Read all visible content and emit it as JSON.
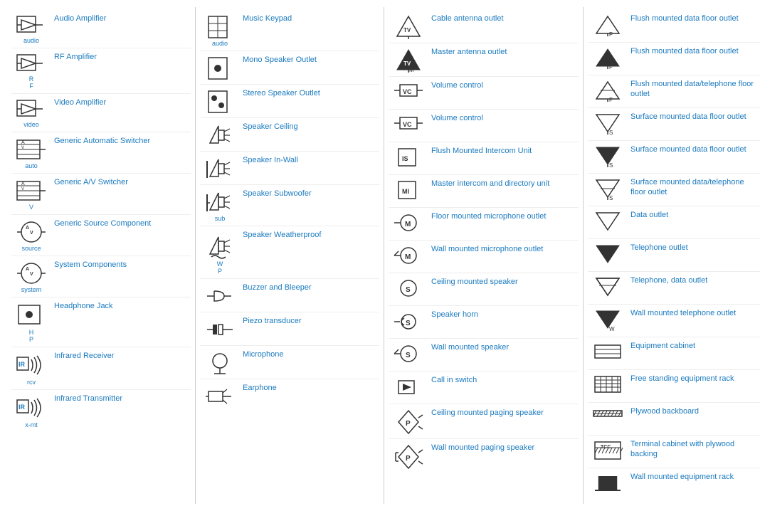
{
  "columns": [
    {
      "items": [
        {
          "id": "audio-amp",
          "label": "Audio Amplifier",
          "abbrev": "audio",
          "symbol": "audio-amp"
        },
        {
          "id": "rf-amp",
          "label": "RF Amplifier",
          "abbrev": "R\nF",
          "symbol": "rf-amp"
        },
        {
          "id": "video-amp",
          "label": "Video Amplifier",
          "abbrev": "video",
          "symbol": "video-amp"
        },
        {
          "id": "generic-auto-switcher",
          "label": "Generic Automatic Switcher",
          "abbrev": "auto",
          "symbol": "auto-switcher"
        },
        {
          "id": "generic-av-switcher",
          "label": "Generic A/V Switcher",
          "abbrev": "V",
          "symbol": "av-switcher"
        },
        {
          "id": "generic-source",
          "label": "Generic Source Component",
          "abbrev": "source",
          "symbol": "source"
        },
        {
          "id": "system-components",
          "label": "System Components",
          "abbrev": "system",
          "symbol": "system"
        },
        {
          "id": "headphone-jack",
          "label": "Headphone Jack",
          "abbrev": "H\nP",
          "symbol": "headphone"
        },
        {
          "id": "infrared-receiver",
          "label": "Infrared Receiver",
          "abbrev": "rcv",
          "symbol": "ir-receiver"
        },
        {
          "id": "infrared-transmitter",
          "label": "Infrared Transmitter",
          "abbrev": "x-mt",
          "symbol": "ir-transmitter"
        }
      ]
    },
    {
      "items": [
        {
          "id": "music-keypad",
          "label": "Music Keypad",
          "abbrev": "audio",
          "symbol": "music-keypad"
        },
        {
          "id": "mono-speaker",
          "label": "Mono Speaker Outlet",
          "abbrev": "",
          "symbol": "mono-speaker"
        },
        {
          "id": "stereo-speaker",
          "label": "Stereo Speaker Outlet",
          "abbrev": "",
          "symbol": "stereo-speaker"
        },
        {
          "id": "speaker-ceiling",
          "label": "Speaker Ceiling",
          "abbrev": "",
          "symbol": "speaker-ceiling"
        },
        {
          "id": "speaker-inwall",
          "label": "Speaker In-Wall",
          "abbrev": "",
          "symbol": "speaker-inwall"
        },
        {
          "id": "speaker-sub",
          "label": "Speaker Subwoofer",
          "abbrev": "sub",
          "symbol": "speaker-sub"
        },
        {
          "id": "speaker-weather",
          "label": "Speaker Weatherproof",
          "abbrev": "W\nP",
          "symbol": "speaker-weather"
        },
        {
          "id": "buzzer",
          "label": "Buzzer and Bleeper",
          "abbrev": "",
          "symbol": "buzzer"
        },
        {
          "id": "piezo",
          "label": "Piezo transducer",
          "abbrev": "",
          "symbol": "piezo"
        },
        {
          "id": "microphone",
          "label": "Microphone",
          "abbrev": "",
          "symbol": "microphone"
        },
        {
          "id": "earphone",
          "label": "Earphone",
          "abbrev": "",
          "symbol": "earphone"
        }
      ]
    },
    {
      "items": [
        {
          "id": "cable-antenna",
          "label": "Cable antenna outlet",
          "abbrev": "",
          "symbol": "cable-antenna"
        },
        {
          "id": "master-antenna",
          "label": "Master antenna outlet",
          "abbrev": "",
          "symbol": "master-antenna"
        },
        {
          "id": "volume-control-1",
          "label": "Volume control",
          "abbrev": "",
          "symbol": "volume-control-1"
        },
        {
          "id": "volume-control-2",
          "label": "Volume control",
          "abbrev": "",
          "symbol": "volume-control-2"
        },
        {
          "id": "flush-intercom",
          "label": "Flush Mounted Intercom Unit",
          "abbrev": "",
          "symbol": "flush-intercom"
        },
        {
          "id": "master-intercom",
          "label": "Master intercom and directory unit",
          "abbrev": "",
          "symbol": "master-intercom"
        },
        {
          "id": "floor-mic",
          "label": "Floor mounted microphone outlet",
          "abbrev": "",
          "symbol": "floor-mic"
        },
        {
          "id": "wall-mic",
          "label": "Wall mounted microphone outlet",
          "abbrev": "",
          "symbol": "wall-mic"
        },
        {
          "id": "ceiling-speaker",
          "label": "Ceiling mounted speaker",
          "abbrev": "",
          "symbol": "ceiling-speaker"
        },
        {
          "id": "speaker-horn",
          "label": "Speaker horn",
          "abbrev": "",
          "symbol": "speaker-horn"
        },
        {
          "id": "wall-speaker",
          "label": "Wall mounted speaker",
          "abbrev": "",
          "symbol": "wall-speaker"
        },
        {
          "id": "call-switch",
          "label": "Call in switch",
          "abbrev": "",
          "symbol": "call-switch"
        },
        {
          "id": "ceiling-paging",
          "label": "Ceiling mounted paging speaker",
          "abbrev": "",
          "symbol": "ceiling-paging"
        },
        {
          "id": "wall-paging",
          "label": "Wall mounted paging speaker",
          "abbrev": "",
          "symbol": "wall-paging"
        }
      ]
    },
    {
      "items": [
        {
          "id": "flush-data-floor-1",
          "label": "Flush mounted data floor outlet",
          "abbrev": "F",
          "symbol": "flush-data-1"
        },
        {
          "id": "flush-data-floor-2",
          "label": "Flush mounted data floor outlet",
          "abbrev": "F",
          "symbol": "flush-data-2"
        },
        {
          "id": "flush-data-tel",
          "label": "Flush mounted data/telephone floor outlet",
          "abbrev": "F",
          "symbol": "flush-data-tel"
        },
        {
          "id": "surface-data-1",
          "label": "Surface mounted data floor outlet",
          "abbrev": "S",
          "symbol": "surface-data-1"
        },
        {
          "id": "surface-data-2",
          "label": "Surface mounted data floor outlet",
          "abbrev": "S",
          "symbol": "surface-data-2"
        },
        {
          "id": "surface-data-tel",
          "label": "Surface mounted data/telephone floor outlet",
          "abbrev": "S",
          "symbol": "surface-data-tel"
        },
        {
          "id": "data-outlet",
          "label": "Data outlet",
          "abbrev": "",
          "symbol": "data-outlet"
        },
        {
          "id": "telephone-outlet",
          "label": "Telephone outlet",
          "abbrev": "",
          "symbol": "telephone-outlet"
        },
        {
          "id": "telephone-data",
          "label": "Telephone, data outlet",
          "abbrev": "",
          "symbol": "telephone-data"
        },
        {
          "id": "wall-telephone",
          "label": "Wall mounted telephone outlet",
          "abbrev": "W",
          "symbol": "wall-telephone"
        },
        {
          "id": "equipment-cabinet",
          "label": "Equipment cabinet",
          "abbrev": "",
          "symbol": "equipment-cabinet"
        },
        {
          "id": "free-standing-rack",
          "label": "Free standing equipment rack",
          "abbrev": "",
          "symbol": "free-standing-rack"
        },
        {
          "id": "plywood-backboard",
          "label": "Plywood backboard",
          "abbrev": "",
          "symbol": "plywood-backboard"
        },
        {
          "id": "terminal-cabinet",
          "label": "Terminal cabinet with plywood backing",
          "abbrev": "TCC",
          "symbol": "terminal-cabinet"
        },
        {
          "id": "wall-equipment-rack",
          "label": "Wall mounted equipment rack",
          "abbrev": "",
          "symbol": "wall-equipment-rack"
        }
      ]
    }
  ]
}
